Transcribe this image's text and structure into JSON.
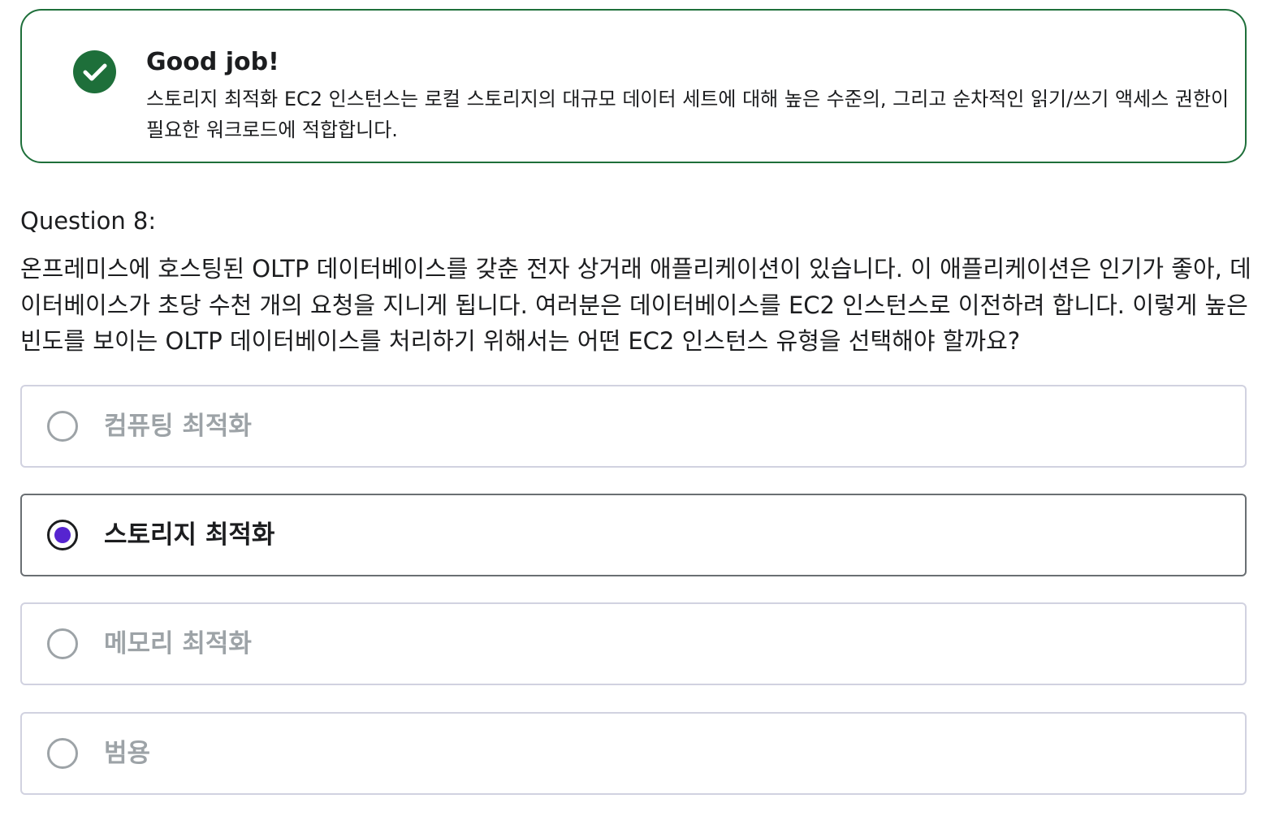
{
  "feedback": {
    "status_icon": "check-circle-icon",
    "title": "Good job!",
    "text": "스토리지 최적화 EC2 인스턴스는 로컬 스토리지의 대규모 데이터 세트에 대해 높은 수준의, 그리고 순차적인 읽기/쓰기 액세스 권한이 필요한 워크로드에 적합합니다.",
    "color": "#1e6f3a"
  },
  "question": {
    "label": "Question 8:",
    "text": "온프레미스에 호스팅된 OLTP 데이터베이스를 갖춘 전자 상거래 애플리케이션이 있습니다. 이 애플리케이션은 인기가 좋아, 데이터베이스가 초당 수천 개의 요청을 지니게 됩니다. 여러분은 데이터베이스를 EC2 인스턴스로 이전하려 합니다. 이렇게 높은 빈도를 보이는 OLTP 데이터베이스를 처리하기 위해서는 어떤 EC2 인스턴스 유형을 선택해야 할까요?"
  },
  "options": [
    {
      "label": "컴퓨팅 최적화",
      "selected": false
    },
    {
      "label": "스토리지 최적화",
      "selected": true
    },
    {
      "label": "메모리 최적화",
      "selected": false
    },
    {
      "label": "범용",
      "selected": false
    }
  ],
  "colors": {
    "accent": "#5624d0",
    "success": "#1e6f3a",
    "text": "#1c1d1f",
    "muted": "#9da3a7"
  }
}
